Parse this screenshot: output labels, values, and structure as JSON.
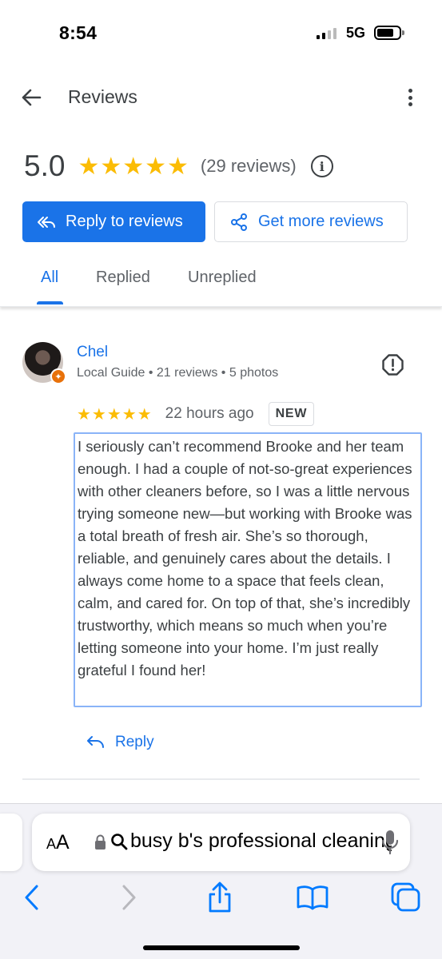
{
  "status_bar": {
    "time": "8:54",
    "network": "5G"
  },
  "appbar": {
    "title": "Reviews"
  },
  "summary": {
    "score": "5.0",
    "stars": "★★★★★",
    "count": "(29 reviews)"
  },
  "actions": {
    "reply_label": "Reply to reviews",
    "more_label": "Get more reviews"
  },
  "tabs": [
    {
      "label": "All",
      "selected": true
    },
    {
      "label": "Replied",
      "selected": false
    },
    {
      "label": "Unreplied",
      "selected": false
    }
  ],
  "review": {
    "name": "Chel",
    "meta": "Local Guide • 21 reviews • 5 photos",
    "stars": "★★★★★",
    "time": "22 hours ago",
    "badge": "NEW",
    "text": "I seriously can’t recommend Brooke and her team enough. I had a couple of not-so-great experiences with other cleaners before, so I was a little nervous trying someone new—but working with Brooke was a total breath of fresh air. She’s so thorough, reliable, and genuinely cares about the details. I always come home to a space that feels clean, calm, and cared for. On top of that, she’s incredibly trustworthy, which means so much when you’re letting someone into your home. I’m just really grateful I found her!",
    "reply_label": "Reply"
  },
  "browser": {
    "aa_big": "A",
    "aa_small": "A",
    "url": "busy b's professional cleaning"
  },
  "colors": {
    "accent": "#1a73e8",
    "star": "#fbbc04",
    "orange_badge": "#e8710a"
  }
}
